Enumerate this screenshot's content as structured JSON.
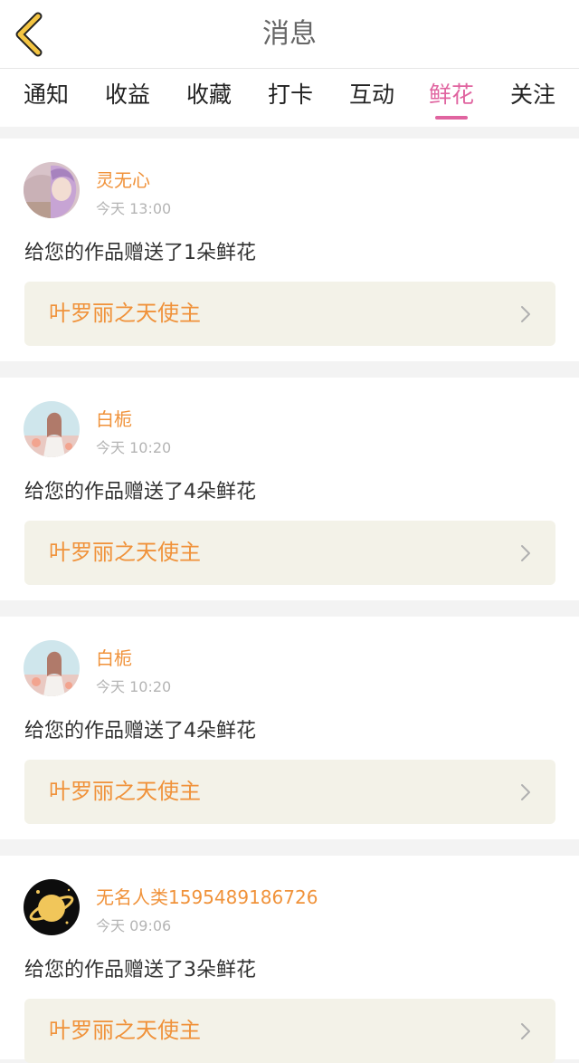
{
  "header": {
    "title": "消息"
  },
  "tabs": [
    {
      "label": "通知"
    },
    {
      "label": "收益"
    },
    {
      "label": "收藏"
    },
    {
      "label": "打卡"
    },
    {
      "label": "互动"
    },
    {
      "label": "鲜花",
      "active": true
    },
    {
      "label": "关注"
    }
  ],
  "colors": {
    "accent_pink": "#e064a0",
    "name_orange": "#f0923a",
    "link_bg": "#f3f2e8"
  },
  "messages": [
    {
      "username": "灵无心",
      "time": "今天 13:00",
      "text": "给您的作品赠送了1朵鲜花",
      "work_title": "叶罗丽之天使主",
      "avatar": "anime-girl-purple-avatar"
    },
    {
      "username": "白栀",
      "time": "今天 10:20",
      "text": "给您的作品赠送了4朵鲜花",
      "work_title": "叶罗丽之天使主",
      "avatar": "anime-girl-pastel-avatar"
    },
    {
      "username": "白栀",
      "time": "今天 10:20",
      "text": "给您的作品赠送了4朵鲜花",
      "work_title": "叶罗丽之天使主",
      "avatar": "anime-girl-pastel-avatar"
    },
    {
      "username": "无名人类1595489186726",
      "time": "今天 09:06",
      "text": "给您的作品赠送了3朵鲜花",
      "work_title": "叶罗丽之天使主",
      "avatar": "planet-black-avatar"
    }
  ]
}
